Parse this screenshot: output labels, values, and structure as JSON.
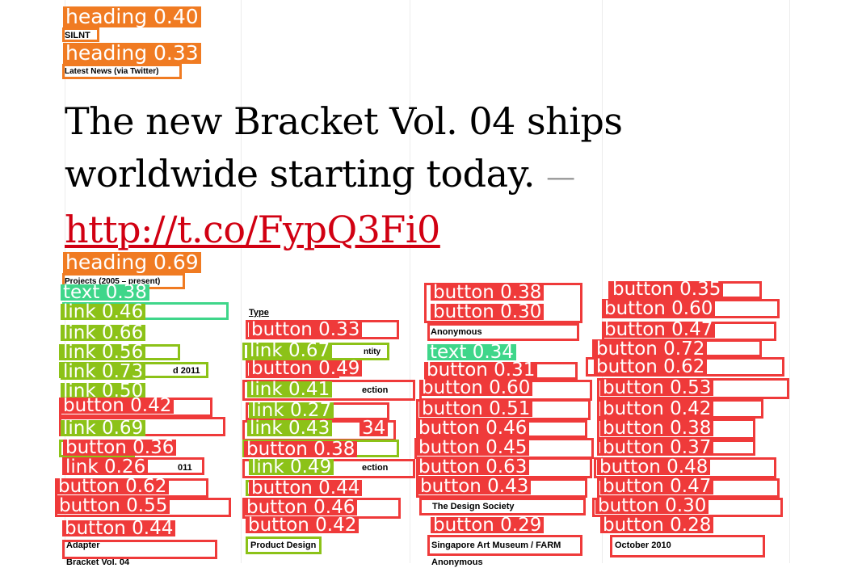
{
  "labels": {
    "silnt": "SILNT",
    "latest_news": "Latest News (via Twitter)",
    "projects": "Projects (2005 – present)",
    "type": "Type",
    "anonymous_top": "Anonymous",
    "anonymous_bottom": "Anonymous",
    "identity_fragment": "ntity",
    "award_fragment": "d 2011",
    "collection_fragment_1": "ection",
    "collection_fragment_2": "ection",
    "award_fragment_2": "011",
    "design_society": "The Design Society",
    "singapore": "Singapore Art Museum / FARM",
    "october": "October 2010",
    "adapter": "Adapter",
    "product_design": "Product Design",
    "bracket_cut": "Bracket Vol. 04"
  },
  "tweet": {
    "text": "The new Bracket Vol. 04 ships worldwide starting today.",
    "dash": "—",
    "link": "http://t.co/FypQ3Fi0"
  },
  "detections": [
    "heading 0.40",
    "heading 0.33",
    "heading 0.69",
    "text 0.38",
    "link 0.46",
    "link 0.66",
    "link 0.56",
    "link 0.73",
    "link 0.50",
    "button 0.42",
    "link 0.69",
    "button 0.36",
    "link 0.26",
    "button 0.62",
    "button 0.55",
    "button 0.44",
    "button 0.33",
    "link 0.67",
    "button 0.49",
    "link 0.41",
    "link 0.27",
    "link 0.43",
    "34",
    "button 0.38",
    "link 0.49",
    "button 0.44",
    "button 0.46",
    "button 0.42",
    "button 0.38",
    "button 0.30",
    "text 0.34",
    "button 0.31",
    "button 0.60",
    "button 0.51",
    "button 0.46",
    "button 0.45",
    "button 0.63",
    "button 0.43",
    "button 0.29",
    "button 0.35",
    "button 0.60",
    "button 0.47",
    "button 0.72",
    "button 0.62",
    "button 0.53",
    "button 0.42",
    "button 0.38",
    "button 0.37",
    "button 0.48",
    "button 0.47",
    "button 0.30",
    "button 0.28"
  ],
  "colors": {
    "button": "#ef3a3a",
    "link": "#8cc218",
    "text": "#3fd68a",
    "heading": "#f07b22",
    "tweet_link": "#d10012"
  }
}
